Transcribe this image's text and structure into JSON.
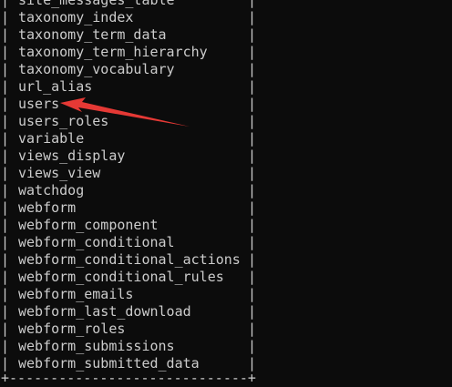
{
  "terminal": {
    "pipe": "|",
    "rows": [
      "site_messages_table",
      "taxonomy_index",
      "taxonomy_term_data",
      "taxonomy_term_hierarchy",
      "taxonomy_vocabulary",
      "url_alias",
      "users",
      "users_roles",
      "variable",
      "views_display",
      "views_view",
      "watchdog",
      "webform",
      "webform_component",
      "webform_conditional",
      "webform_conditional_actions",
      "webform_conditional_rules",
      "webform_emails",
      "webform_last_download",
      "webform_roles",
      "webform_submissions",
      "webform_submitted_data"
    ],
    "bottom_border": "+-----------------------------+"
  },
  "annotation": {
    "arrow_color": "#e53935",
    "arrow_target": "users"
  }
}
